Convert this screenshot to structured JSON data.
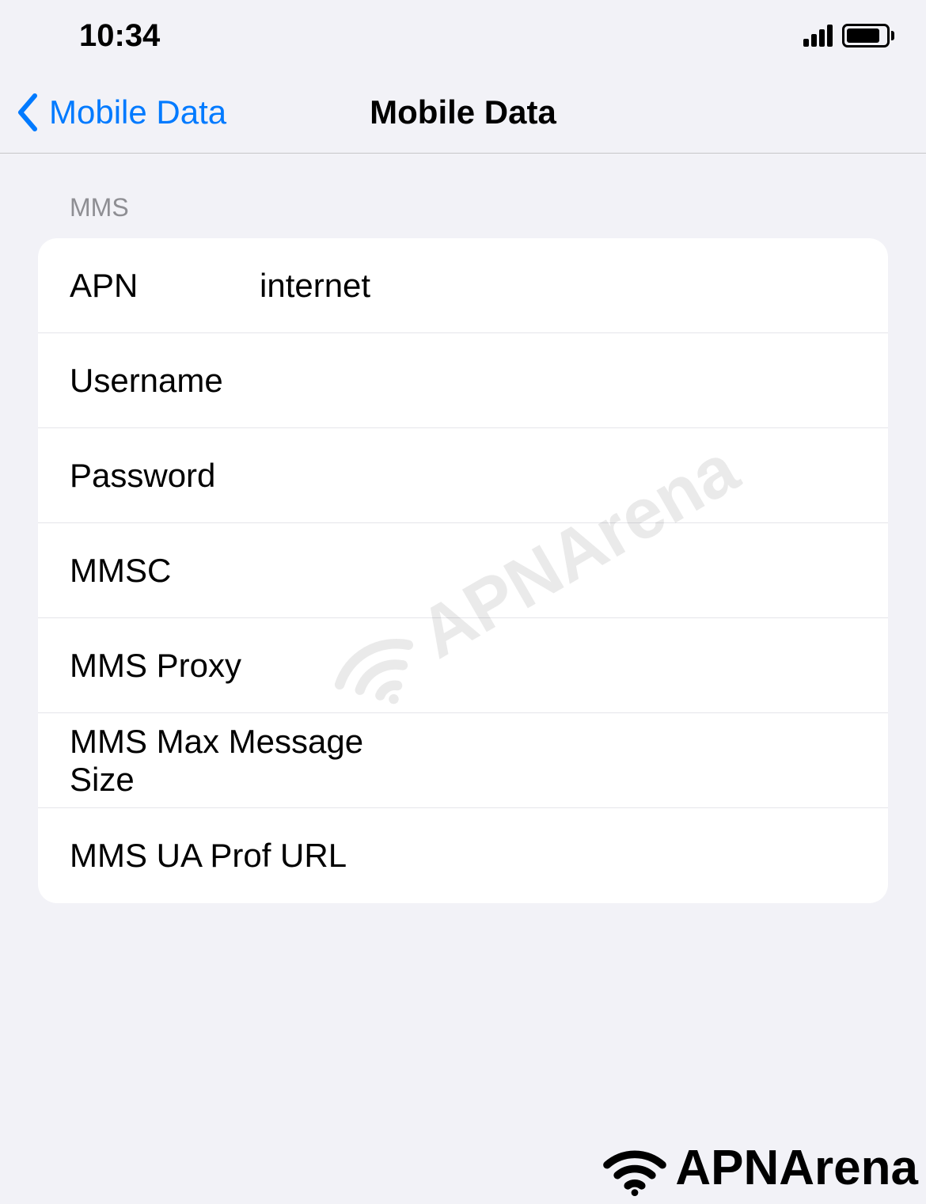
{
  "status_bar": {
    "time": "10:34"
  },
  "nav": {
    "back_label": "Mobile Data",
    "title": "Mobile Data"
  },
  "section": {
    "header": "MMS",
    "rows": {
      "apn": {
        "label": "APN",
        "value": "internet"
      },
      "username": {
        "label": "Username",
        "value": ""
      },
      "password": {
        "label": "Password",
        "value": ""
      },
      "mmsc": {
        "label": "MMSC",
        "value": ""
      },
      "mms_proxy": {
        "label": "MMS Proxy",
        "value": ""
      },
      "mms_max_size": {
        "label": "MMS Max Message Size",
        "value": ""
      },
      "mms_ua_prof": {
        "label": "MMS UA Prof URL",
        "value": ""
      }
    }
  },
  "watermark": {
    "text": "APNArena"
  }
}
